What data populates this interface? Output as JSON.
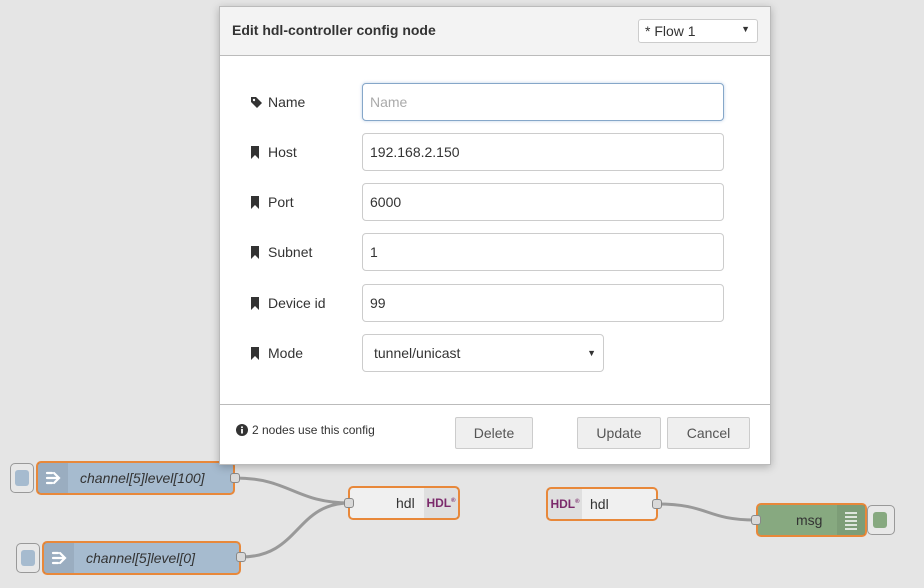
{
  "dialog": {
    "title": "Edit hdl-controller config node",
    "flow_select": "* Flow 1",
    "fields": {
      "name": {
        "label": "Name",
        "placeholder": "Name",
        "value": ""
      },
      "host": {
        "label": "Host",
        "value": "192.168.2.150"
      },
      "port": {
        "label": "Port",
        "value": "6000"
      },
      "subnet": {
        "label": "Subnet",
        "value": "1"
      },
      "device_id": {
        "label": "Device id",
        "value": "99"
      },
      "mode": {
        "label": "Mode",
        "value": "tunnel/unicast"
      }
    },
    "usage_text": "2 nodes use this config",
    "buttons": {
      "delete": "Delete",
      "update": "Update",
      "cancel": "Cancel"
    }
  },
  "flow": {
    "nodes": {
      "inject1": {
        "label": "channel[5]level[100]"
      },
      "inject2": {
        "label": "channel[5]level[0]"
      },
      "hdl_out": {
        "label": "hdl",
        "logo": "HDL"
      },
      "hdl_in": {
        "label": "hdl",
        "logo": "HDL"
      },
      "debug": {
        "label": "msg"
      }
    }
  },
  "colors": {
    "canvas": "#e5e5e5",
    "node_border": "#e8883a",
    "inject_fill": "#a6bbcf",
    "debug_fill": "#87a980",
    "hdl_logo": "#7b2a6b"
  },
  "icons": {
    "name": "tag-icon",
    "fields": "bookmark-icon",
    "usage": "info-icon",
    "inject": "arrow-in-icon",
    "debug": "list-icon"
  }
}
